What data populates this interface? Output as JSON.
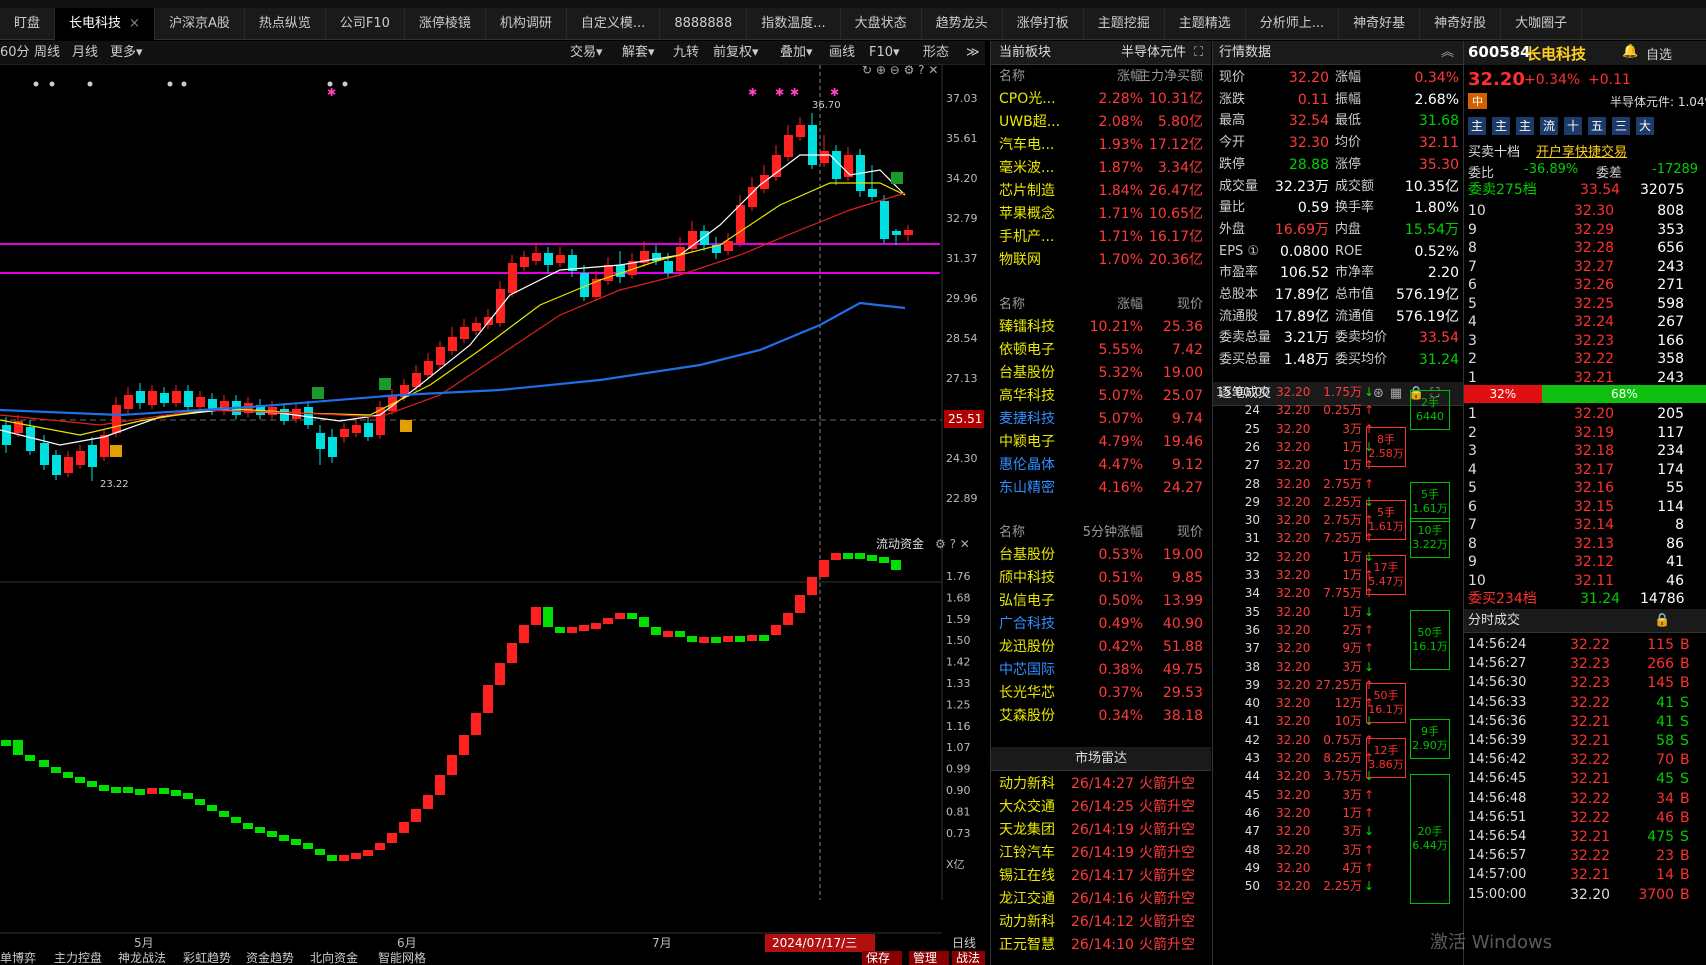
{
  "window": {
    "tabs": [
      {
        "label": "盯盘"
      },
      {
        "label": "长电科技",
        "closable": true,
        "active": true
      },
      {
        "label": "沪深京A股"
      },
      {
        "label": "热点纵览"
      },
      {
        "label": "公司F10"
      },
      {
        "label": "涨停棱镜"
      },
      {
        "label": "机构调研"
      },
      {
        "label": "自定义模..."
      },
      {
        "label": "8888888"
      },
      {
        "label": "指数温度..."
      },
      {
        "label": "大盘状态"
      },
      {
        "label": "趋势龙头"
      },
      {
        "label": "涨停打板"
      },
      {
        "label": "主题挖掘"
      },
      {
        "label": "主题精选"
      },
      {
        "label": "分析师上..."
      },
      {
        "label": "神奇好基"
      },
      {
        "label": "神奇好股"
      },
      {
        "label": "大咖圈子"
      }
    ]
  },
  "toolbar": {
    "left": [
      "60分",
      "周线",
      "月线",
      "更多▾"
    ],
    "right": [
      "交易▾",
      "解套▾",
      "九转",
      "前复权▾",
      "叠加▾",
      "画线",
      "F10▾",
      "形态",
      "≫"
    ]
  },
  "chart": {
    "price_labels": [
      "37.03",
      "35.61",
      "34.20",
      "32.79",
      "31.37",
      "29.96",
      "28.54",
      "27.13",
      "25.71",
      "24.30",
      "22.89"
    ],
    "current_price_tag": "25.51",
    "high_label": "36.70",
    "low_label": "23.22",
    "date_labels": [
      "5月",
      "6月",
      "7月"
    ],
    "cursor_date": "2024/07/17/三",
    "sub_title": "流动资金",
    "sub_labels": [
      "1.76",
      "1.68",
      "1.59",
      "1.50",
      "1.42",
      "1.33",
      "1.25",
      "1.16",
      "1.07",
      "0.99",
      "0.90",
      "0.81",
      "0.73"
    ],
    "sub_unit": "X亿",
    "period": "日线",
    "bottom_tabs": [
      "单博弈",
      "主力控盘",
      "神龙战法",
      "彩虹趋势",
      "资金趋势",
      "北向资金",
      "智能网格"
    ],
    "bottom_buttons": [
      "保存",
      "管理",
      "战法"
    ]
  },
  "sector": {
    "title": "当前板块",
    "subtitle": "半导体元件",
    "headers": [
      "名称",
      "涨幅",
      "主力净买额"
    ],
    "rows": [
      [
        "CPO光...",
        "2.28%",
        "10.31亿"
      ],
      [
        "UWB超...",
        "2.08%",
        "5.80亿"
      ],
      [
        "汽车电...",
        "1.93%",
        "17.12亿"
      ],
      [
        "毫米波...",
        "1.87%",
        "3.34亿"
      ],
      [
        "芯片制造",
        "1.84%",
        "26.47亿"
      ],
      [
        "苹果概念",
        "1.71%",
        "10.65亿"
      ],
      [
        "手机产...",
        "1.71%",
        "16.17亿"
      ],
      [
        "物联网",
        "1.70%",
        "20.36亿"
      ]
    ]
  },
  "peers": {
    "headers": [
      "名称",
      "涨幅",
      "现价"
    ],
    "rows": [
      [
        "臻镭科技",
        "10.21%",
        "25.36"
      ],
      [
        "依顿电子",
        "5.55%",
        "7.42"
      ],
      [
        "台基股份",
        "5.32%",
        "19.00"
      ],
      [
        "高华科技",
        "5.07%",
        "25.07"
      ],
      [
        "麦捷科技",
        "5.07%",
        "9.74"
      ],
      [
        "中颖电子",
        "4.79%",
        "19.46"
      ],
      [
        "惠伦晶体",
        "4.47%",
        "9.12"
      ],
      [
        "东山精密",
        "4.16%",
        "24.27"
      ]
    ]
  },
  "fivemin": {
    "headers": [
      "名称",
      "5分钟涨幅",
      "现价"
    ],
    "rows": [
      [
        "台基股份",
        "0.53%",
        "19.00"
      ],
      [
        "颀中科技",
        "0.51%",
        "9.85"
      ],
      [
        "弘信电子",
        "0.50%",
        "13.99"
      ],
      [
        "广合科技",
        "0.49%",
        "40.90"
      ],
      [
        "龙迅股份",
        "0.42%",
        "51.88"
      ],
      [
        "中芯国际",
        "0.38%",
        "49.75"
      ],
      [
        "长光华芯",
        "0.37%",
        "29.53"
      ],
      [
        "艾森股份",
        "0.34%",
        "38.18"
      ]
    ]
  },
  "radar": {
    "title": "市场雷达",
    "rows": [
      [
        "动力新科",
        "26/14:27",
        "火箭升空"
      ],
      [
        "大众交通",
        "26/14:25",
        "火箭升空"
      ],
      [
        "天龙集团",
        "26/14:19",
        "火箭升空"
      ],
      [
        "江铃汽车",
        "26/14:19",
        "火箭升空"
      ],
      [
        "锡江在线",
        "26/14:17",
        "火箭升空"
      ],
      [
        "龙江交通",
        "26/14:16",
        "火箭升空"
      ],
      [
        "动力新科",
        "26/14:12",
        "火箭升空"
      ],
      [
        "正元智慧",
        "26/14:10",
        "火箭升空"
      ]
    ]
  },
  "quote": {
    "title": "行情数据",
    "rows": [
      [
        "现价",
        "32.20",
        "涨幅",
        "0.34%"
      ],
      [
        "涨跌",
        "0.11",
        "振幅",
        "2.68%"
      ],
      [
        "最高",
        "32.54",
        "最低",
        "31.68"
      ],
      [
        "今开",
        "32.30",
        "均价",
        "32.11"
      ],
      [
        "跌停",
        "28.88",
        "涨停",
        "35.30"
      ],
      [
        "成交量",
        "32.23万",
        "成交额",
        "10.35亿"
      ],
      [
        "量比",
        "0.59",
        "换手率",
        "1.80%"
      ],
      [
        "外盘",
        "16.69万",
        "内盘",
        "15.54万"
      ],
      [
        "EPS ①",
        "0.0800",
        "ROE",
        "0.52%"
      ],
      [
        "市盈率",
        "106.52",
        "市净率",
        "2.20"
      ],
      [
        "总股本",
        "17.89亿",
        "总市值",
        "576.19亿"
      ],
      [
        "流通股",
        "17.89亿",
        "流通值",
        "576.19亿"
      ],
      [
        "委卖总量",
        "3.21万",
        "委卖均价",
        "33.54"
      ],
      [
        "委买总量",
        "1.48万",
        "委买均价",
        "31.24"
      ]
    ]
  },
  "ticks": {
    "title": "逐笔成交",
    "rows": [
      [
        "15:00:00",
        "32.20",
        "1.75万"
      ],
      [
        "24",
        "32.20",
        "0.25万"
      ],
      [
        "25",
        "32.20",
        "3万"
      ],
      [
        "26",
        "32.20",
        "1万"
      ],
      [
        "27",
        "32.20",
        "1万"
      ],
      [
        "28",
        "32.20",
        "2.75万"
      ],
      [
        "29",
        "32.20",
        "2.25万"
      ],
      [
        "30",
        "32.20",
        "2.75万"
      ],
      [
        "31",
        "32.20",
        "7.25万"
      ],
      [
        "32",
        "32.20",
        "1万"
      ],
      [
        "33",
        "32.20",
        "1万"
      ],
      [
        "34",
        "32.20",
        "7.75万"
      ],
      [
        "35",
        "32.20",
        "1万"
      ],
      [
        "36",
        "32.20",
        "2万"
      ],
      [
        "37",
        "32.20",
        "9万"
      ],
      [
        "38",
        "32.20",
        "3万"
      ],
      [
        "39",
        "32.20",
        "27.25万"
      ],
      [
        "40",
        "32.20",
        "12万"
      ],
      [
        "41",
        "32.20",
        "10万"
      ],
      [
        "42",
        "32.20",
        "0.75万"
      ],
      [
        "43",
        "32.20",
        "8.25万"
      ],
      [
        "44",
        "32.20",
        "3.75万"
      ],
      [
        "45",
        "32.20",
        "3万"
      ],
      [
        "46",
        "32.20",
        "1万"
      ],
      [
        "47",
        "32.20",
        "3万"
      ],
      [
        "48",
        "32.20",
        "3万"
      ],
      [
        "49",
        "32.20",
        "4万"
      ],
      [
        "50",
        "32.20",
        "2.25万"
      ]
    ],
    "boxes": [
      [
        "2手",
        "6440"
      ],
      [
        "8手",
        "2.58万"
      ],
      [
        "5手",
        "1.61万"
      ],
      [
        "10手",
        "3.22万"
      ],
      [
        "5手",
        "1.61万"
      ],
      [
        "17手",
        "5.47万"
      ],
      [
        "50手",
        "16.1万"
      ],
      [
        "50手",
        "16.1万"
      ],
      [
        "9手",
        "2.90万"
      ],
      [
        "12手",
        "3.86万"
      ],
      [
        "20手",
        "6.44万"
      ]
    ]
  },
  "stock": {
    "code": "600584",
    "name": "长电科技",
    "price": "32.20",
    "change_pct": "+0.34%",
    "change": "+0.11",
    "tag": "中",
    "sector": "半导体元件: 1.04%",
    "watch": "自选",
    "order_title": "买卖十档",
    "trade_link": "开户享快捷交易",
    "weibi_label": "委比",
    "weibi": "-36.89%",
    "weicha_label": "委差",
    "weicha": "-17289",
    "ask_top_label": "委卖275档",
    "ask_top_price": "33.54",
    "ask_top_vol": "32075",
    "bid_bottom_label": "委买234档",
    "bid_bottom_price": "31.24",
    "bid_bottom_vol": "14786",
    "sell_pct": "32%",
    "buy_pct": "68%",
    "asks": [
      [
        "10",
        "32.30",
        "808"
      ],
      [
        "9",
        "32.29",
        "353"
      ],
      [
        "8",
        "32.28",
        "656"
      ],
      [
        "7",
        "32.27",
        "243"
      ],
      [
        "6",
        "32.26",
        "271"
      ],
      [
        "5",
        "32.25",
        "598"
      ],
      [
        "4",
        "32.24",
        "267"
      ],
      [
        "3",
        "32.23",
        "166"
      ],
      [
        "2",
        "32.22",
        "358"
      ],
      [
        "1",
        "32.21",
        "243"
      ]
    ],
    "bids": [
      [
        "1",
        "32.20",
        "205"
      ],
      [
        "2",
        "32.19",
        "117"
      ],
      [
        "3",
        "32.18",
        "234"
      ],
      [
        "4",
        "32.17",
        "174"
      ],
      [
        "5",
        "32.16",
        "55"
      ],
      [
        "6",
        "32.15",
        "114"
      ],
      [
        "7",
        "32.14",
        "8"
      ],
      [
        "8",
        "32.13",
        "86"
      ],
      [
        "9",
        "32.12",
        "41"
      ],
      [
        "10",
        "32.11",
        "46"
      ]
    ],
    "ts_title": "分时成交",
    "ts": [
      [
        "14:56:24",
        "32.22",
        "115",
        "B"
      ],
      [
        "14:56:27",
        "32.23",
        "266",
        "B"
      ],
      [
        "14:56:30",
        "32.23",
        "145",
        "B"
      ],
      [
        "14:56:33",
        "32.22",
        "41",
        "S"
      ],
      [
        "14:56:36",
        "32.21",
        "41",
        "S"
      ],
      [
        "14:56:39",
        "32.21",
        "58",
        "S"
      ],
      [
        "14:56:42",
        "32.22",
        "70",
        "B"
      ],
      [
        "14:56:45",
        "32.21",
        "45",
        "S"
      ],
      [
        "14:56:48",
        "32.22",
        "34",
        "B"
      ],
      [
        "14:56:51",
        "32.22",
        "46",
        "B"
      ],
      [
        "14:56:54",
        "32.21",
        "475",
        "S"
      ],
      [
        "14:56:57",
        "32.22",
        "23",
        "B"
      ],
      [
        "14:57:00",
        "32.21",
        "14",
        "B"
      ],
      [
        "15:00:00",
        "32.20",
        "3700",
        "B"
      ]
    ],
    "watermark": "激活 Windows"
  },
  "colors": {
    "up": "#ff2020",
    "down": "#00e0e0",
    "ma5": "#ffffff",
    "ma10": "#e8e800",
    "ma20": "#e02020",
    "ma60": "#1e6fe8",
    "support": "#e000e0"
  }
}
